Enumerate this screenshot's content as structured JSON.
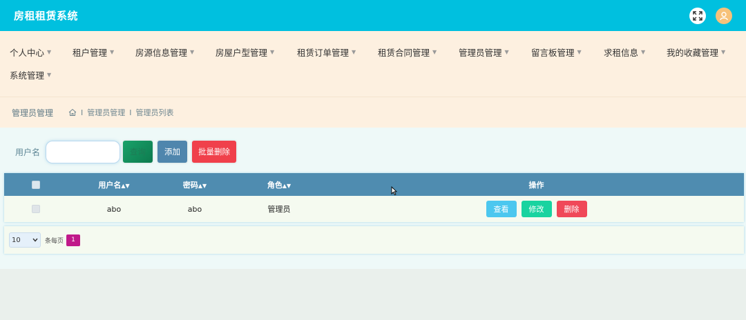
{
  "app": {
    "title": "房租租赁系统"
  },
  "icons": {
    "fullscreen": "fullscreen-icon",
    "avatar": "user-icon",
    "home": "home-icon"
  },
  "colors": {
    "header": "#00c0df",
    "nav_bg": "#fdf0e0",
    "table_head": "#4f8cb0",
    "danger": "#f0404b",
    "primary": "#4f86ad"
  },
  "nav": {
    "row1": [
      {
        "label": "个人中心"
      },
      {
        "label": "租户管理"
      },
      {
        "label": "房源信息管理"
      },
      {
        "label": "房屋户型管理"
      },
      {
        "label": "租赁订单管理"
      },
      {
        "label": "租赁合同管理"
      },
      {
        "label": "管理员管理"
      },
      {
        "label": "留言板管理"
      },
      {
        "label": "求租信息"
      },
      {
        "label": "我的收藏管理"
      }
    ],
    "row2": [
      {
        "label": "系统管理"
      }
    ]
  },
  "breadcrumb": {
    "title": "管理员管理",
    "items": [
      "管理员管理",
      "管理员列表"
    ],
    "separator": "I"
  },
  "search": {
    "label": "用户名",
    "value": "",
    "placeholder": "",
    "search_btn": "查询",
    "add_btn": "添加",
    "batch_delete_btn": "批量删除"
  },
  "table": {
    "headers": {
      "username": "用户名",
      "password": "密码",
      "role": "角色",
      "ops": "操作"
    },
    "rows": [
      {
        "username": "abo",
        "password": "abo",
        "role": "管理员",
        "view": "查看",
        "edit": "修改",
        "delete": "删除"
      }
    ]
  },
  "pager": {
    "page_size": "10",
    "per_page_text": "条每页",
    "current_page": "1"
  }
}
